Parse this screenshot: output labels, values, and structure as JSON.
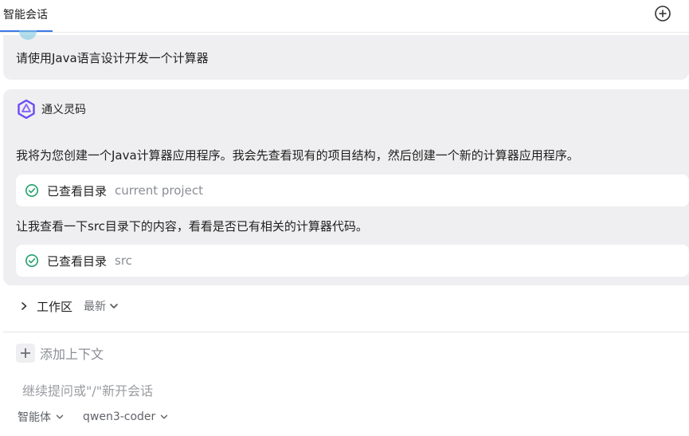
{
  "header": {
    "tab_label": "智能会话"
  },
  "user_message": {
    "text": "请使用Java语言设计开发一个计算器"
  },
  "assistant": {
    "name": "通义灵码",
    "paragraph1": "我将为您创建一个Java计算器应用程序。我会先查看现有的项目结构，然后创建一个新的计算器应用程序。",
    "tool1": {
      "label": "已查看目录",
      "arg": "current project"
    },
    "paragraph2": "让我查看一下src目录下的内容，看看是否已有相关的计算器代码。",
    "tool2": {
      "label": "已查看目录",
      "arg": "src"
    }
  },
  "workspace": {
    "label": "工作区",
    "sort": "最新"
  },
  "input": {
    "add_context": "添加上下文",
    "placeholder": "继续提问或\"/\"新开会话",
    "mode": "智能体",
    "model": "qwen3-coder"
  },
  "colors": {
    "accent": "#3b78e7",
    "check_green": "#22a06b",
    "logo_purple": "#6a4bf5"
  }
}
